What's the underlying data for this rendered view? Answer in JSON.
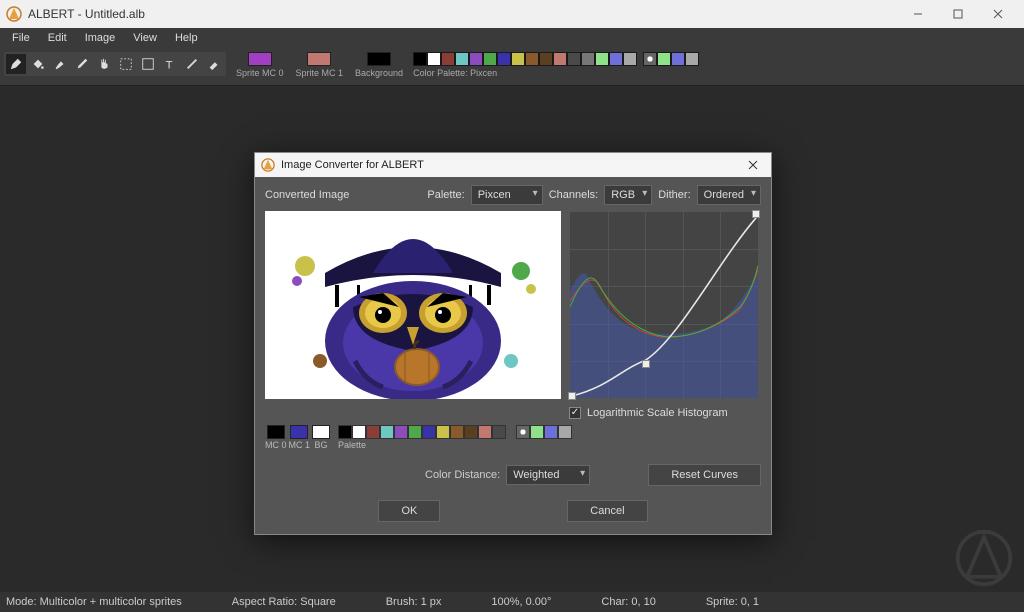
{
  "window": {
    "title": "ALBERT - Untitled.alb"
  },
  "menu": {
    "items": [
      "File",
      "Edit",
      "Image",
      "View",
      "Help"
    ]
  },
  "tools": {
    "names": [
      "pencil",
      "bucket",
      "brush",
      "eyedropper",
      "hand",
      "marquee-dotted",
      "marquee",
      "text",
      "line",
      "eraser"
    ]
  },
  "sprite_colors": {
    "mc0": {
      "label": "Sprite MC 0",
      "color": "#a040c0"
    },
    "mc1": {
      "label": "Sprite MC 1",
      "color": "#c07870"
    },
    "bg": {
      "label": "Background",
      "color": "#000000"
    }
  },
  "palette": {
    "label": "Color Palette: Pixcen",
    "colors": [
      "#000000",
      "#ffffff",
      "#8a3f36",
      "#6fc7c4",
      "#8b4cc0",
      "#4fa84a",
      "#3a32a8",
      "#c8c24a",
      "#8b5a2b",
      "#5a4020",
      "#c07870",
      "#4a4a4a",
      "#777777",
      "#8fe28a",
      "#6f6fd8",
      "#a8a8a8"
    ]
  },
  "statusbar": {
    "mode": "Mode: Multicolor + multicolor sprites",
    "aspect": "Aspect Ratio: Square",
    "brush": "Brush: 1 px",
    "zoom": "100%, 0.00°",
    "char": "Char: 0, 10",
    "sprite": "Sprite: 0, 1"
  },
  "dialog": {
    "title": "Image Converter for ALBERT",
    "converted_label": "Converted Image",
    "palette_label": "Palette:",
    "palette_value": "Pixcen",
    "channels_label": "Channels:",
    "channels_value": "RGB",
    "dither_label": "Dither:",
    "dither_value": "Ordered",
    "mc0": {
      "label": "MC 0",
      "color": "#000000"
    },
    "mc1": {
      "label": "MC 1",
      "color": "#3a32a8"
    },
    "bg": {
      "label": "BG",
      "color": "#ffffff"
    },
    "pal_label": "Palette",
    "pal_colors": [
      "#000000",
      "#ffffff",
      "#8a3f36",
      "#6fc7c4",
      "#8b4cc0",
      "#4fa84a",
      "#3a32a8",
      "#c8c24a",
      "#8b5a2b",
      "#5a4020",
      "#c07870",
      "#4a4a4a",
      "#777777",
      "#8fe28a",
      "#6f6fd8",
      "#a8a8a8"
    ],
    "log_histogram": "Logarithmic Scale Histogram",
    "color_distance_label": "Color Distance:",
    "color_distance_value": "Weighted",
    "reset_curves": "Reset Curves",
    "ok": "OK",
    "cancel": "Cancel"
  }
}
